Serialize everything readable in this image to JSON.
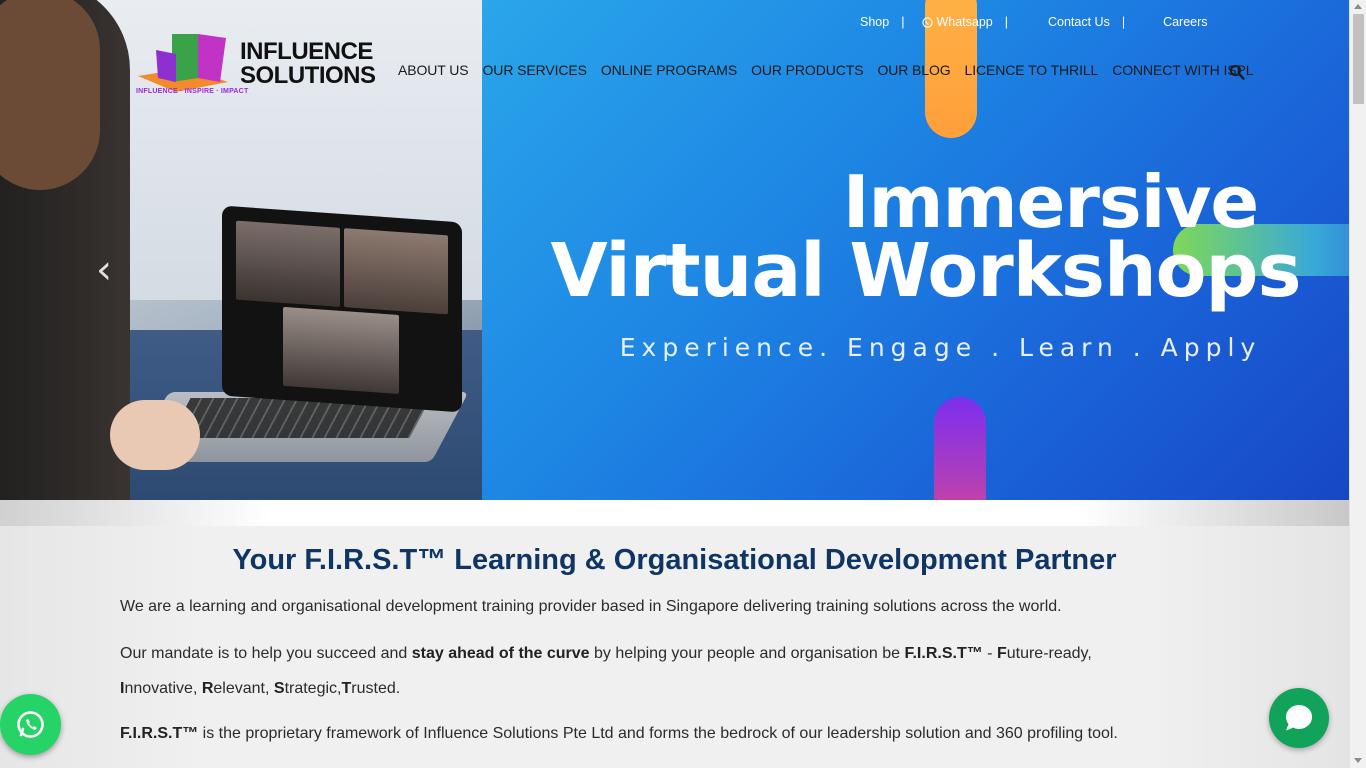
{
  "brand": {
    "name_line1": "INFLUENCE",
    "name_line2": "SOLUTIONS",
    "tagline": "INFLUENCE · INSPIRE · IMPACT"
  },
  "top_links": [
    {
      "label": "Shop"
    },
    {
      "label": "Whatsapp",
      "icon": "whatsapp-icon"
    },
    {
      "label": "Contact Us"
    },
    {
      "label": "Careers"
    }
  ],
  "nav": [
    {
      "label": "ABOUT US"
    },
    {
      "label": "OUR SERVICES"
    },
    {
      "label": "ONLINE PROGRAMS"
    },
    {
      "label": "OUR PRODUCTS"
    },
    {
      "label": "OUR BLOG"
    },
    {
      "label": "LICENCE TO THRILL"
    },
    {
      "label": "CONNECT WITH ISPL"
    }
  ],
  "nav_search_icon": "search-icon",
  "hero": {
    "title_line1": "Immersive",
    "title_line2": "Virtual Workshops",
    "subtitle": "Experience. Engage . Learn . Apply",
    "prev_arrow": "‹",
    "next_arrow": "›"
  },
  "content": {
    "headline": "Your F.I.R.S.T™ Learning & Organisational Development Partner",
    "p1": "We are a learning and organisational development training provider based in Singapore delivering training solutions across the world.",
    "p2_a": "Our mandate is to help you succeed and ",
    "p2_b": "stay ahead of the curve",
    "p2_c": " by helping your people and organisation be ",
    "p2_d": "F.I.R.S.T™",
    "p2_e": " - ",
    "p2_f1": "F",
    "p2_f2": "uture-ready,",
    "p2_i1": "I",
    "p2_i2": "nnovative, ",
    "p2_r1": "R",
    "p2_r2": "elevant, ",
    "p2_s1": "S",
    "p2_s2": "trategic,",
    "p2_t1": "T",
    "p2_t2": "rusted.",
    "p3_a": "F.I.R.S.T™",
    "p3_b": " is the proprietary framework of Influence Solutions Pte Ltd and forms the bedrock of our leadership solution and 360 profiling tool."
  },
  "colors": {
    "heading": "#0e3563",
    "whatsapp": "#25d366",
    "chat": "#11a35a"
  }
}
